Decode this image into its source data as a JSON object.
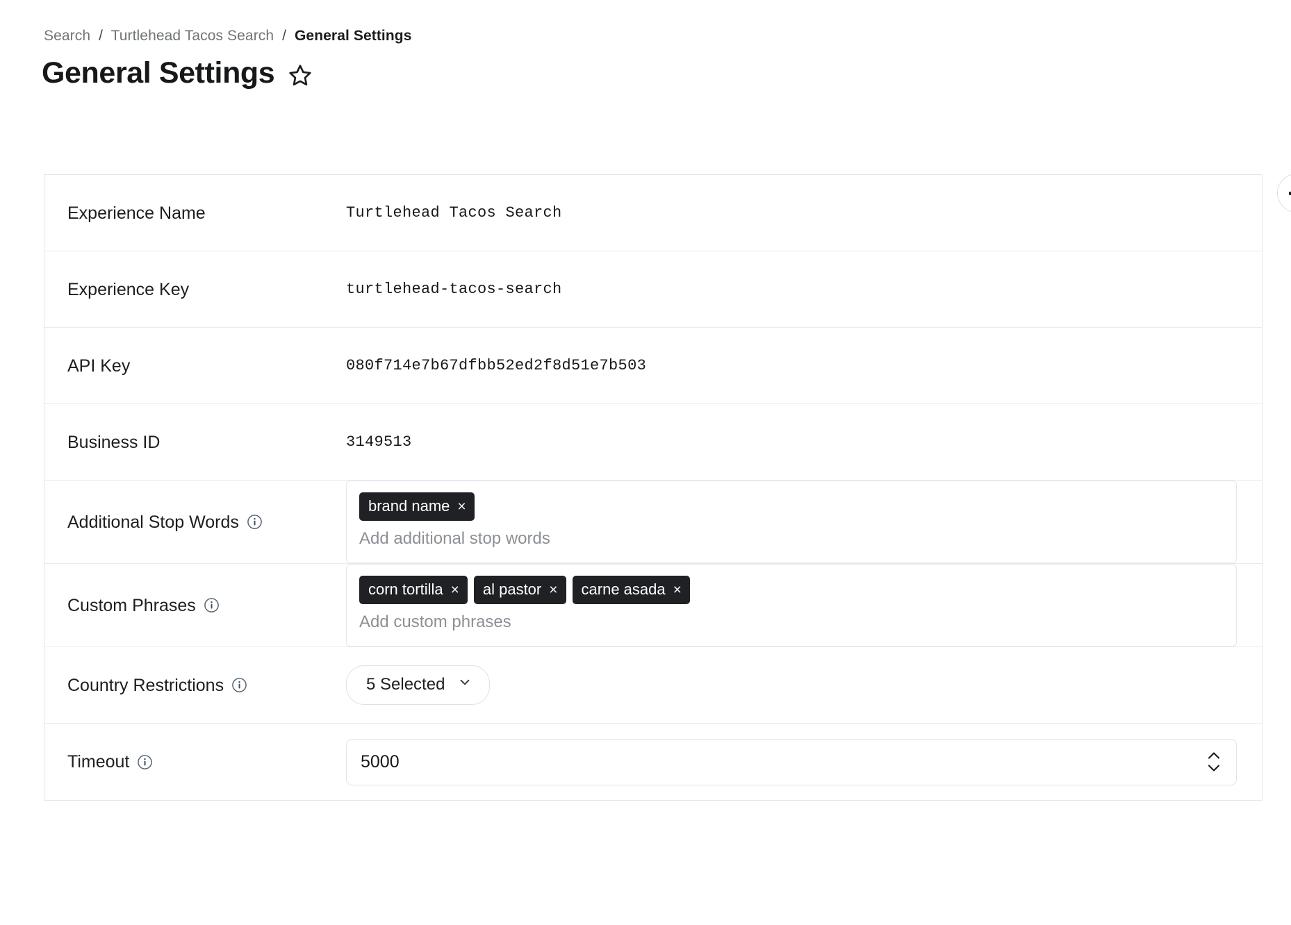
{
  "breadcrumb": {
    "items": [
      {
        "label": "Search",
        "current": false
      },
      {
        "label": "Turtlehead Tacos Search",
        "current": false
      },
      {
        "label": "General Settings",
        "current": true
      }
    ],
    "separator": "/"
  },
  "header": {
    "title": "General Settings",
    "favorite_icon": "star-outline-icon"
  },
  "floating_button": {
    "icon": "collapse-panel-icon"
  },
  "settings": {
    "rows": [
      {
        "key": "experience-name",
        "label": "Experience Name",
        "type": "text",
        "value": "Turtlehead Tacos Search",
        "has_info": false
      },
      {
        "key": "experience-key",
        "label": "Experience Key",
        "type": "text",
        "value": "turtlehead-tacos-search",
        "has_info": false
      },
      {
        "key": "api-key",
        "label": "API Key",
        "type": "text",
        "value": "080f714e7b67dfbb52ed2f8d51e7b503",
        "has_info": false
      },
      {
        "key": "business-id",
        "label": "Business ID",
        "type": "text",
        "value": "3149513",
        "has_info": false
      },
      {
        "key": "additional-stop-words",
        "label": "Additional Stop Words",
        "type": "tags",
        "has_info": true,
        "info_icon": "info-circle-icon",
        "tags": [
          "brand name"
        ],
        "placeholder": "Add additional stop words",
        "remove_glyph": "×"
      },
      {
        "key": "custom-phrases",
        "label": "Custom Phrases",
        "type": "tags",
        "has_info": true,
        "info_icon": "info-circle-icon",
        "tags": [
          "corn tortilla",
          "al pastor",
          "carne asada"
        ],
        "placeholder": "Add custom phrases",
        "remove_glyph": "×"
      },
      {
        "key": "country-restrictions",
        "label": "Country Restrictions",
        "type": "select",
        "has_info": true,
        "info_icon": "info-circle-icon",
        "value": "5 Selected",
        "chevron_icon": "chevron-down-icon"
      },
      {
        "key": "timeout",
        "label": "Timeout",
        "type": "number",
        "has_info": true,
        "info_icon": "info-circle-icon",
        "value": "5000",
        "stepper_icon": "stepper-up-down-icon"
      }
    ]
  },
  "colors": {
    "text_primary": "#17191b",
    "text_muted": "#6f7478",
    "chip_background": "#1f2124",
    "chip_text": "#ffffff",
    "border": "#e4e5e9",
    "info_icon": "#4b5a6a",
    "placeholder": "#8c9095"
  }
}
